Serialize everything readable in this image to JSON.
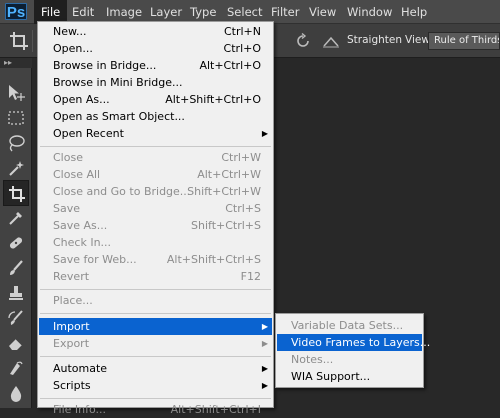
{
  "app": {
    "logo": "Ps"
  },
  "menubar": [
    "File",
    "Edit",
    "Image",
    "Layer",
    "Type",
    "Select",
    "Filter",
    "View",
    "Window",
    "Help"
  ],
  "options": {
    "straighten_label": "Straighten",
    "view_label": "View:",
    "view_value": "Rule of Thirds"
  },
  "file_menu": [
    {
      "label": "New...",
      "shortcut": "Ctrl+N",
      "enabled": true
    },
    {
      "label": "Open...",
      "shortcut": "Ctrl+O",
      "enabled": true
    },
    {
      "label": "Browse in Bridge...",
      "shortcut": "Alt+Ctrl+O",
      "enabled": true
    },
    {
      "label": "Browse in Mini Bridge...",
      "shortcut": "",
      "enabled": true
    },
    {
      "label": "Open As...",
      "shortcut": "Alt+Shift+Ctrl+O",
      "enabled": true
    },
    {
      "label": "Open as Smart Object...",
      "shortcut": "",
      "enabled": true
    },
    {
      "label": "Open Recent",
      "shortcut": "",
      "enabled": true,
      "submenu": true
    },
    {
      "label": "Close",
      "shortcut": "Ctrl+W",
      "enabled": false
    },
    {
      "label": "Close All",
      "shortcut": "Alt+Ctrl+W",
      "enabled": false
    },
    {
      "label": "Close and Go to Bridge...",
      "shortcut": "Shift+Ctrl+W",
      "enabled": false
    },
    {
      "label": "Save",
      "shortcut": "Ctrl+S",
      "enabled": false
    },
    {
      "label": "Save As...",
      "shortcut": "Shift+Ctrl+S",
      "enabled": false
    },
    {
      "label": "Check In...",
      "shortcut": "",
      "enabled": false
    },
    {
      "label": "Save for Web...",
      "shortcut": "Alt+Shift+Ctrl+S",
      "enabled": false
    },
    {
      "label": "Revert",
      "shortcut": "F12",
      "enabled": false
    },
    {
      "label": "Place...",
      "shortcut": "",
      "enabled": false
    },
    {
      "label": "Import",
      "shortcut": "",
      "enabled": true,
      "submenu": true,
      "highlighted": true
    },
    {
      "label": "Export",
      "shortcut": "",
      "enabled": false,
      "submenu": true
    },
    {
      "label": "Automate",
      "shortcut": "",
      "enabled": true,
      "submenu": true
    },
    {
      "label": "Scripts",
      "shortcut": "",
      "enabled": true,
      "submenu": true
    },
    {
      "label": "File Info...",
      "shortcut": "Alt+Shift+Ctrl+I",
      "enabled": false
    }
  ],
  "import_submenu": [
    {
      "label": "Variable Data Sets...",
      "enabled": false
    },
    {
      "label": "Video Frames to Layers...",
      "enabled": true,
      "highlighted": true
    },
    {
      "label": "Notes...",
      "enabled": false
    },
    {
      "label": "WIA Support...",
      "enabled": true
    }
  ],
  "tools": [
    "move-icon",
    "marquee-icon",
    "lasso-icon",
    "quick-selection-icon",
    "crop-icon",
    "eyedropper-icon",
    "healing-brush-icon",
    "brush-icon",
    "clone-stamp-icon",
    "history-brush-icon",
    "eraser-icon",
    "gradient-icon",
    "blur-icon",
    "dodge-icon"
  ],
  "colors": {
    "highlight": "#0a63d0",
    "menu_bg": "#f0f0f0",
    "disabled_text": "#8d8d8d"
  }
}
